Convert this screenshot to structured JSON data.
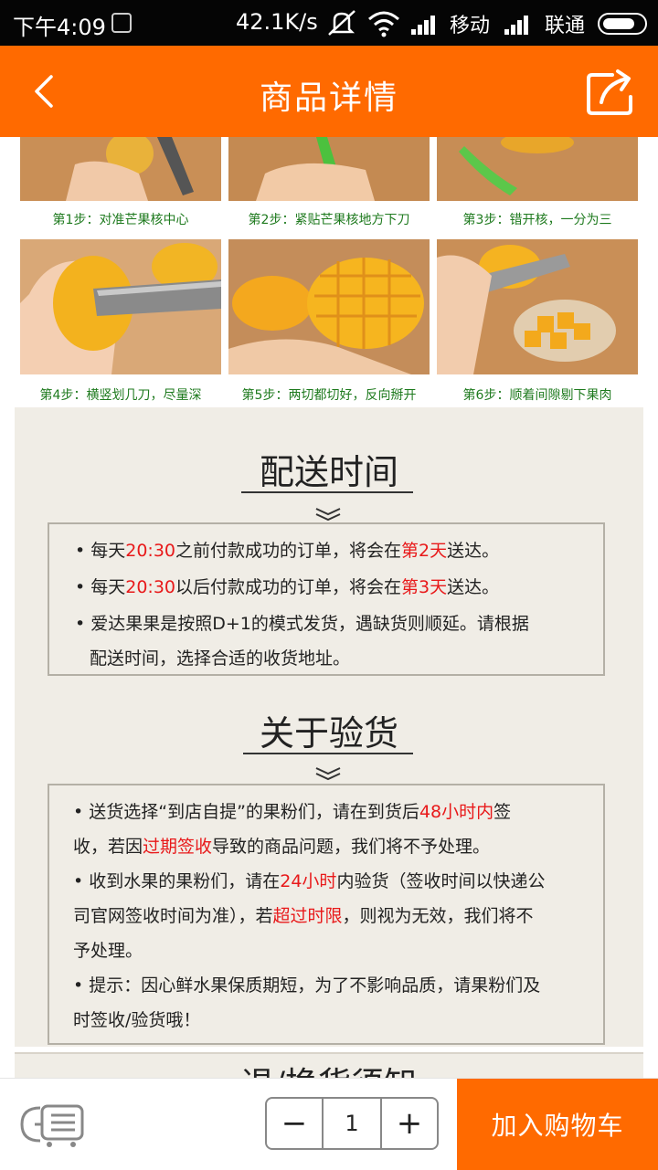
{
  "status_bar": {
    "time": "下午4:09",
    "speed": "42.1K/s",
    "carrier1": "移动",
    "carrier2": "联通"
  },
  "header": {
    "title": "商品详情",
    "back_icon": "chevron-left-icon",
    "share_icon": "share-icon"
  },
  "steps": [
    {
      "label": "第1步：对准芒果核中心"
    },
    {
      "label": "第2步：紧贴芒果核地方下刀"
    },
    {
      "label": "第3步：错开核，一分为三"
    },
    {
      "label": "第4步：横竖划几刀，尽量深"
    },
    {
      "label": "第5步：两切都切好，反向掰开"
    },
    {
      "label": "第6步：顺着间隙剔下果肉"
    }
  ],
  "delivery": {
    "title": "配送时间",
    "lines": [
      {
        "a": "• 每天",
        "b": "20:30",
        "c": "之前付款成功的订单，将会在",
        "d": "第2天",
        "e": "送达。"
      },
      {
        "a": "• 每天",
        "b": "20:30",
        "c": "以后付款成功的订单，将会在",
        "d": "第3天",
        "e": "送达。"
      }
    ],
    "line3": "• 爱达果果是按照D+1的模式发货，遇缺货则顺延。请根据",
    "line4": "配送时间，选择合适的收货地址。"
  },
  "inspection": {
    "title": "关于验货",
    "p1a": "• 送货选择“到店自提”的果粉们，请在到货后",
    "p1b": "48小时内",
    "p1c": "签",
    "p2a": "收，若因",
    "p2b": "过期签收",
    "p2c": "导致的商品问题，我们将不予处理。",
    "p3a": "• 收到水果的果粉们，请在",
    "p3b": "24小时",
    "p3c": "内验货（签收时间以快递公",
    "p4a": "司官网签收时间为准），若",
    "p4b": "超过时限",
    "p4c": "，则视为无效，我们将不",
    "p5": "予处理。",
    "p6": "• 提示：因心鲜水果保质期短，为了不影响品质，请果粉们及",
    "p7": "时签收/验货哦！"
  },
  "returns": {
    "title": "退/换货须知"
  },
  "bottom": {
    "quantity": "1",
    "minus": "−",
    "plus": "+",
    "add_to_cart": "加入购物车"
  }
}
